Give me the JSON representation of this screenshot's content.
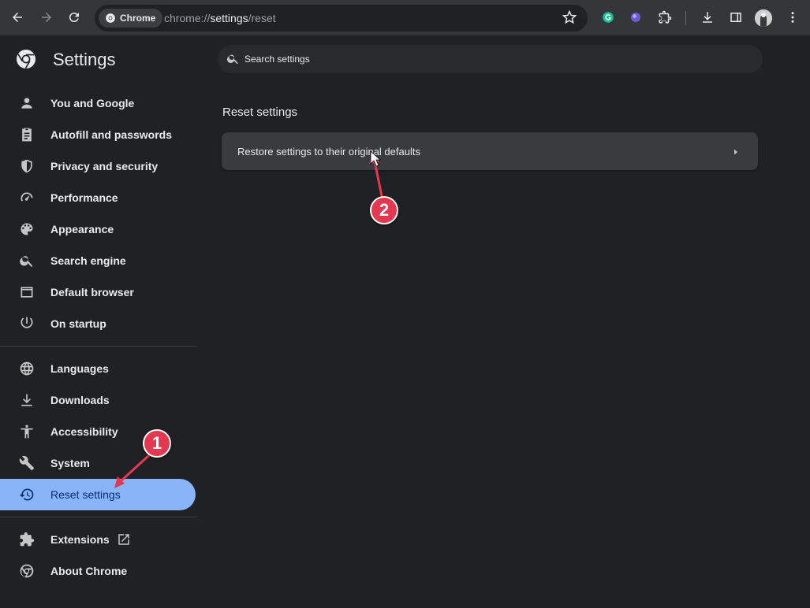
{
  "browser": {
    "chip_label": "Chrome",
    "url_scheme": "chrome://",
    "url_host": "settings",
    "url_path": "/reset"
  },
  "app": {
    "title": "Settings"
  },
  "sidebar": {
    "items": [
      {
        "label": "You and Google",
        "icon": "person-icon"
      },
      {
        "label": "Autofill and passwords",
        "icon": "clipboard-icon"
      },
      {
        "label": "Privacy and security",
        "icon": "shield-icon"
      },
      {
        "label": "Performance",
        "icon": "speedometer-icon"
      },
      {
        "label": "Appearance",
        "icon": "palette-icon"
      },
      {
        "label": "Search engine",
        "icon": "search-icon"
      },
      {
        "label": "Default browser",
        "icon": "browser-window-icon"
      },
      {
        "label": "On startup",
        "icon": "power-icon"
      },
      {
        "label": "Languages",
        "icon": "globe-icon"
      },
      {
        "label": "Downloads",
        "icon": "download-icon"
      },
      {
        "label": "Accessibility",
        "icon": "accessibility-icon"
      },
      {
        "label": "System",
        "icon": "wrench-icon"
      },
      {
        "label": "Reset settings",
        "icon": "history-icon",
        "active": true
      },
      {
        "label": "Extensions",
        "icon": "puzzle-icon"
      },
      {
        "label": "About Chrome",
        "icon": "chrome-logo-icon"
      }
    ]
  },
  "search": {
    "placeholder": "Search settings"
  },
  "main": {
    "section_title": "Reset settings",
    "rows": [
      {
        "label": "Restore settings to their original defaults"
      }
    ]
  },
  "annotations": [
    {
      "label": "1"
    },
    {
      "label": "2"
    }
  ],
  "colors": {
    "active_bg": "#8ab4f8",
    "annotation": "#e5374f",
    "background": "#202124"
  }
}
